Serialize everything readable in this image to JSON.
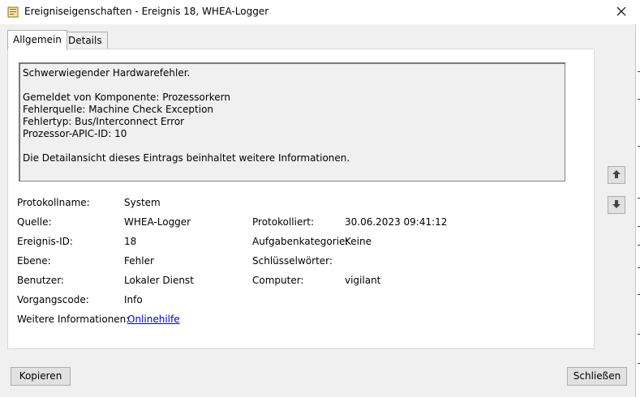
{
  "window": {
    "title": "Ereigniseigenschaften - Ereignis 18, WHEA-Logger"
  },
  "tabs": [
    {
      "label": "Allgemein",
      "active": true
    },
    {
      "label": "Details",
      "active": false
    }
  ],
  "description": {
    "lines": [
      "Schwerwiegender Hardwarefehler.",
      "",
      "Gemeldet von Komponente: Prozessorkern",
      "Fehlerquelle: Machine Check Exception",
      "Fehlertyp: Bus/Interconnect Error",
      "Prozessor-APIC-ID: 10",
      "",
      "Die Detailansicht dieses Eintrags beinhaltet weitere Informationen."
    ]
  },
  "fields": {
    "protokollname": {
      "label": "Protokollname:",
      "value": "System"
    },
    "quelle": {
      "label": "Quelle:",
      "value": "WHEA-Logger"
    },
    "protokolliert": {
      "label": "Protokolliert:",
      "value": "30.06.2023 09:41:12"
    },
    "ereignis_id": {
      "label": "Ereignis-ID:",
      "value": "18"
    },
    "aufgabenkategorie": {
      "label": "Aufgabenkategorie:",
      "value": "Keine"
    },
    "ebene": {
      "label": "Ebene:",
      "value": "Fehler"
    },
    "schluesselwoerter": {
      "label": "Schlüsselwörter:",
      "value": ""
    },
    "benutzer": {
      "label": "Benutzer:",
      "value": "Lokaler Dienst"
    },
    "computer": {
      "label": "Computer:",
      "value": "vigilant"
    },
    "vorgangscode": {
      "label": "Vorgangscode:",
      "value": "Info"
    },
    "weitere": {
      "label": "Weitere Informationen:",
      "value": "Onlinehilfe"
    }
  },
  "buttons": {
    "copy": "Kopieren",
    "close": "Schließen"
  },
  "icons": {
    "close": "close-icon",
    "up": "arrow-up-icon",
    "down": "arrow-down-icon",
    "app": "event-viewer-icon"
  }
}
